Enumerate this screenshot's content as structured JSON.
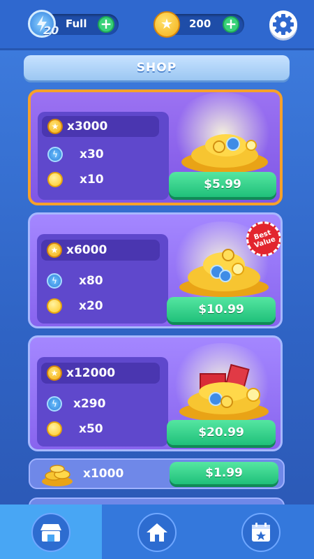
{
  "topbar": {
    "energy_count": "20",
    "energy_status": "Full",
    "coin_balance": "200"
  },
  "shop": {
    "title": "SHOP",
    "packs": [
      {
        "coins": "x3000",
        "energy": "x30",
        "hints": "x10",
        "price": "$5.99",
        "badge": ""
      },
      {
        "coins": "x6000",
        "energy": "x80",
        "hints": "x20",
        "price": "$10.99",
        "badge": "Best Value"
      },
      {
        "coins": "x12000",
        "energy": "x290",
        "hints": "x50",
        "price": "$20.99",
        "badge": ""
      }
    ],
    "coin_offers": [
      {
        "amount": "x1000",
        "price": "$1.99"
      }
    ]
  },
  "nav": {
    "items": [
      {
        "name": "shop",
        "selected": true
      },
      {
        "name": "home",
        "selected": false
      },
      {
        "name": "calendar",
        "selected": false
      }
    ]
  },
  "colors": {
    "accent": "#39d27a",
    "gold": "#f4ae16",
    "purple": "#8864ee"
  }
}
